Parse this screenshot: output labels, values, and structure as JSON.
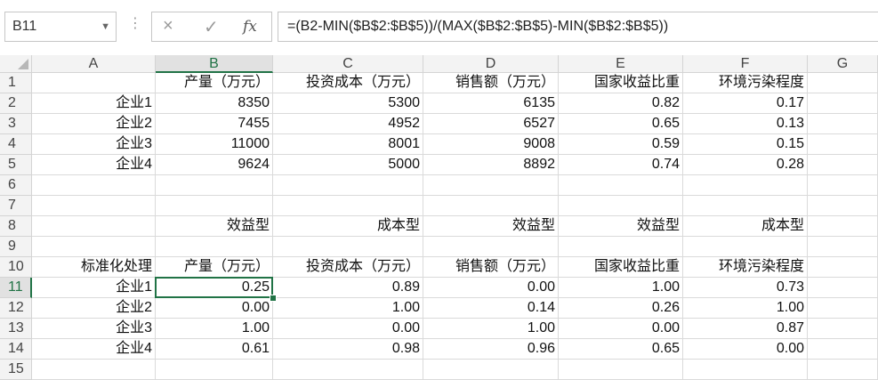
{
  "name_box": {
    "value": "B11"
  },
  "formula_bar": {
    "cancel_icon": "×",
    "enter_icon": "✓",
    "fx_label": "fx",
    "formula": "=(B2-MIN($B$2:$B$5))/(MAX($B$2:$B$5)-MIN($B$2:$B$5))"
  },
  "active_cell": "B11",
  "columns": [
    "A",
    "B",
    "C",
    "D",
    "E",
    "F",
    "G"
  ],
  "rows": [
    "1",
    "2",
    "3",
    "4",
    "5",
    "6",
    "7",
    "8",
    "9",
    "10",
    "11",
    "12",
    "13",
    "14",
    "15"
  ],
  "cells": {
    "r1": {
      "B": "产量（万元）",
      "C": "投资成本（万元）",
      "D": "销售额（万元）",
      "E": "国家收益比重",
      "F": "环境污染程度"
    },
    "r2": {
      "A": "企业1",
      "B": "8350",
      "C": "5300",
      "D": "6135",
      "E": "0.82",
      "F": "0.17"
    },
    "r3": {
      "A": "企业2",
      "B": "7455",
      "C": "4952",
      "D": "6527",
      "E": "0.65",
      "F": "0.13"
    },
    "r4": {
      "A": "企业3",
      "B": "11000",
      "C": "8001",
      "D": "9008",
      "E": "0.59",
      "F": "0.15"
    },
    "r5": {
      "A": "企业4",
      "B": "9624",
      "C": "5000",
      "D": "8892",
      "E": "0.74",
      "F": "0.28"
    },
    "r8": {
      "B": "效益型",
      "C": "成本型",
      "D": "效益型",
      "E": "效益型",
      "F": "成本型"
    },
    "r10": {
      "A": "标准化处理",
      "B": "产量（万元）",
      "C": "投资成本（万元）",
      "D": "销售额（万元）",
      "E": "国家收益比重",
      "F": "环境污染程度"
    },
    "r11": {
      "A": "企业1",
      "B": "0.25",
      "C": "0.89",
      "D": "0.00",
      "E": "1.00",
      "F": "0.73"
    },
    "r12": {
      "A": "企业2",
      "B": "0.00",
      "C": "1.00",
      "D": "0.14",
      "E": "0.26",
      "F": "1.00"
    },
    "r13": {
      "A": "企业3",
      "B": "1.00",
      "C": "0.00",
      "D": "1.00",
      "E": "0.00",
      "F": "0.87"
    },
    "r14": {
      "A": "企业4",
      "B": "0.61",
      "C": "0.98",
      "D": "0.96",
      "E": "0.65",
      "F": "0.00"
    }
  },
  "colors": {
    "accent": "#217346",
    "header_bg": "#f3f3f3",
    "gridline": "#dadada"
  }
}
